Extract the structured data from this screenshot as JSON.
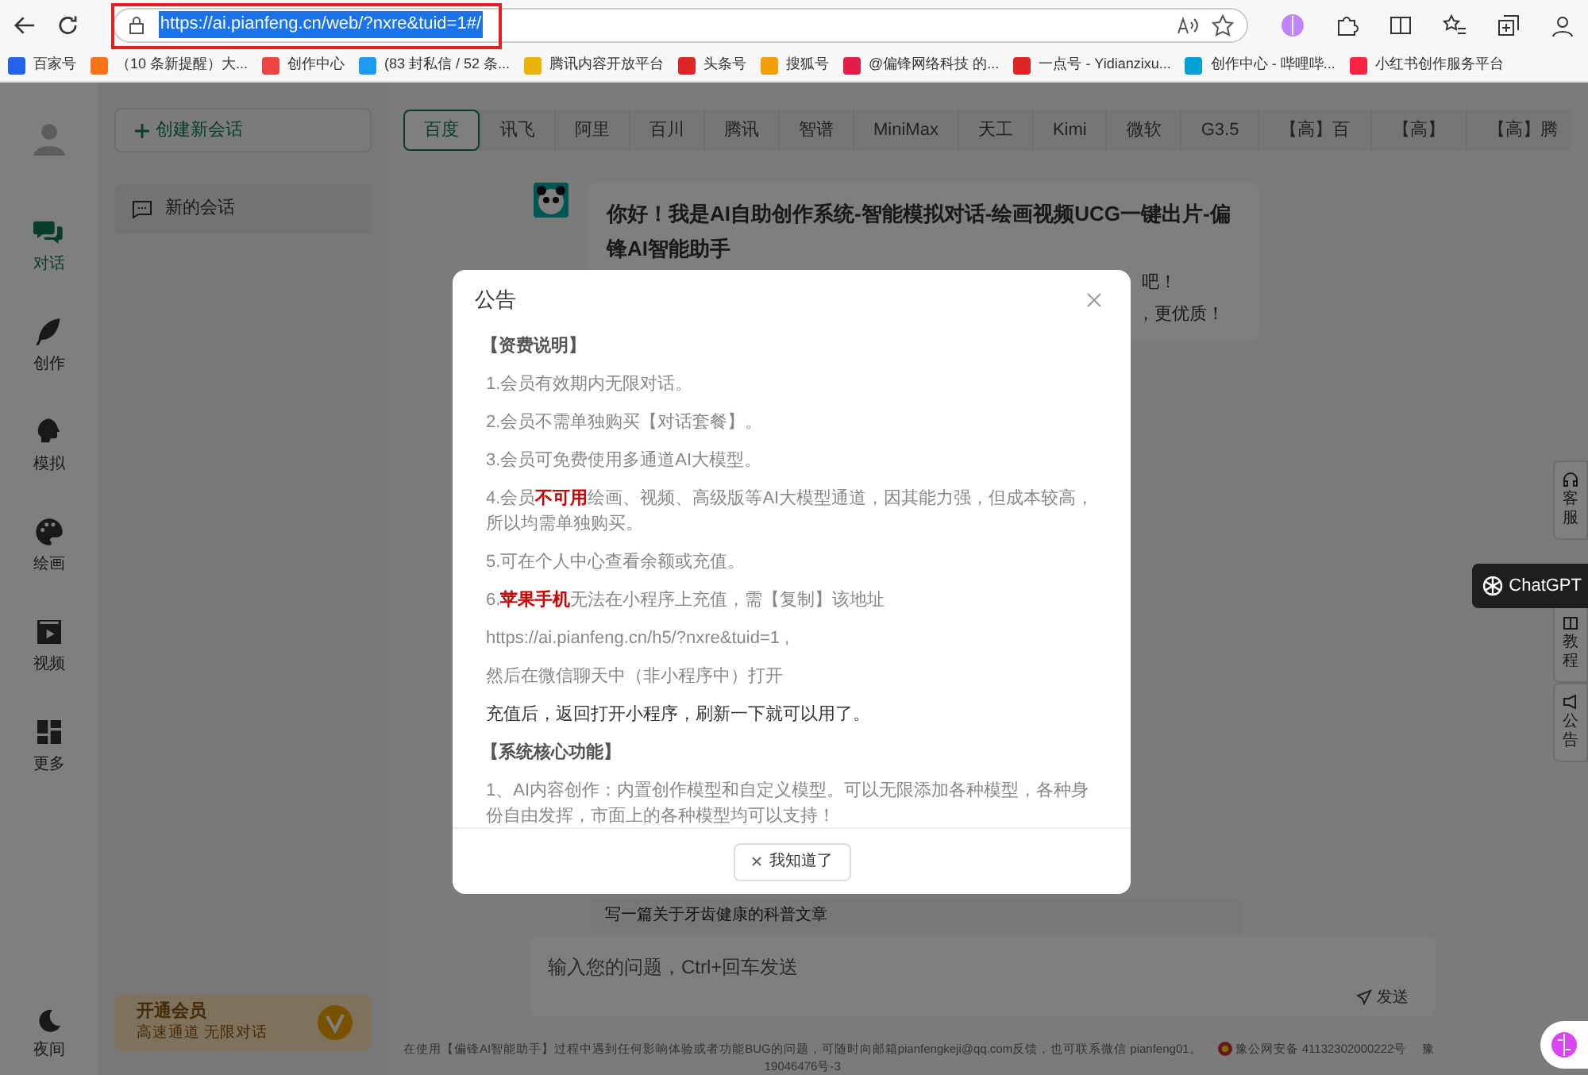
{
  "browser": {
    "url": "https://ai.pianfeng.cn/web/?nxre&tuid=1#/",
    "url_selected": true,
    "url_highlighted": true,
    "bookmarks": [
      {
        "label": "百家号",
        "color": "#2563eb"
      },
      {
        "label": "（10 条新提醒）大...",
        "color": "#f97316"
      },
      {
        "label": "创作中心",
        "color": "#ef4444"
      },
      {
        "label": "(83 封私信 / 52 条...",
        "color": "#1d9bf0"
      },
      {
        "label": "腾讯内容开放平台",
        "color": "#eab308"
      },
      {
        "label": "头条号",
        "color": "#dc2626"
      },
      {
        "label": "搜狐号",
        "color": "#f59e0b"
      },
      {
        "label": "@偏锋网络科技 的...",
        "color": "#e11d48"
      },
      {
        "label": "一点号 - Yidianzixu...",
        "color": "#dc2626"
      },
      {
        "label": "创作中心 - 哔哩哔...",
        "color": "#00a1d6"
      },
      {
        "label": "小红书创作服务平台",
        "color": "#ff2442"
      }
    ]
  },
  "rail": {
    "items": [
      {
        "label": "对话",
        "selected": true
      },
      {
        "label": "创作",
        "selected": false
      },
      {
        "label": "模拟",
        "selected": false
      },
      {
        "label": "绘画",
        "selected": false
      },
      {
        "label": "视频",
        "selected": false
      },
      {
        "label": "更多",
        "selected": false
      }
    ],
    "night": "夜间"
  },
  "panel": {
    "new_chat": "创建新会话",
    "chats": [
      {
        "label": "新的会话"
      }
    ],
    "vip": {
      "title": "开通会员",
      "subtitle": "高速通道 无限对话"
    }
  },
  "tabs": [
    {
      "label": "百度",
      "selected": true
    },
    {
      "label": "讯飞",
      "selected": false
    },
    {
      "label": "阿里",
      "selected": false
    },
    {
      "label": "百川",
      "selected": false
    },
    {
      "label": "腾讯",
      "selected": false
    },
    {
      "label": "智谱",
      "selected": false
    },
    {
      "label": "MiniMax",
      "selected": false
    },
    {
      "label": "天工",
      "selected": false
    },
    {
      "label": "Kimi",
      "selected": false
    },
    {
      "label": "微软",
      "selected": false
    },
    {
      "label": "G3.5",
      "selected": false
    },
    {
      "label": "【高】百",
      "selected": false
    },
    {
      "label": "【高】",
      "selected": false
    },
    {
      "label": "【高】腾",
      "selected": false
    }
  ],
  "message": {
    "title": "你好！我是AI自助创作系统-智能模拟对话-绘画视频UCG一键出片-偏锋AI智能助手",
    "line_1": "吧！",
    "line_2": "，更优质！"
  },
  "suggestion": "写一篇关于牙齿健康的科普文章",
  "input": {
    "placeholder": "输入您的问题，Ctrl+回车发送",
    "send": "发送"
  },
  "footer": {
    "notice": "在使用【偏锋AI智能助手】过程中遇到任何影响体验或者功能BUG的问题，可随时向邮箱pianfengkeji@qq.com反馈，也可联系微信 pianfeng01。",
    "police": "豫公网安备 41132302000222号",
    "icp_cut": "豫",
    "icp_line": "19046476号-3"
  },
  "side_tabs": [
    {
      "label": "客服"
    },
    {
      "label": "教程"
    },
    {
      "label": "公告"
    }
  ],
  "chatgpt_badge": "ChatGPT",
  "dialog": {
    "title": "公告",
    "button": "我知道了",
    "lines": [
      {
        "kind": "heading",
        "text": "【资费说明】"
      },
      {
        "kind": "text",
        "text": "1.会员有效期内无限对话。"
      },
      {
        "kind": "text",
        "text": "2.会员不需单独购买【对话套餐】。"
      },
      {
        "kind": "text",
        "text": "3.会员可免费使用多通道AI大模型。"
      },
      {
        "kind": "text",
        "text": "4.会员**不可用**绘画、视频、高级版等AI大模型通道，因其能力强，但成本较高，所以均需单独购买。"
      },
      {
        "kind": "text",
        "text": "5.可在个人中心查看余额或充值。"
      },
      {
        "kind": "text",
        "text": "6.**苹果手机**无法在小程序上充值，需【复制】该地址"
      },
      {
        "kind": "text",
        "text": "https://ai.pianfeng.cn/h5/?nxre&tuid=1 ,"
      },
      {
        "kind": "text",
        "text": "然后在微信聊天中（非小程序中）打开"
      },
      {
        "kind": "strong",
        "text": "充值后，返回打开小程序，刷新一下就可以用了。"
      },
      {
        "kind": "heading",
        "text": "【系统核心功能】"
      },
      {
        "kind": "text",
        "text": "1、AI内容创作：内置创作模型和自定义模型。可以无限添加各种模型，各种身份自由发挥，市面上的各种模型均可以支持！"
      }
    ]
  }
}
